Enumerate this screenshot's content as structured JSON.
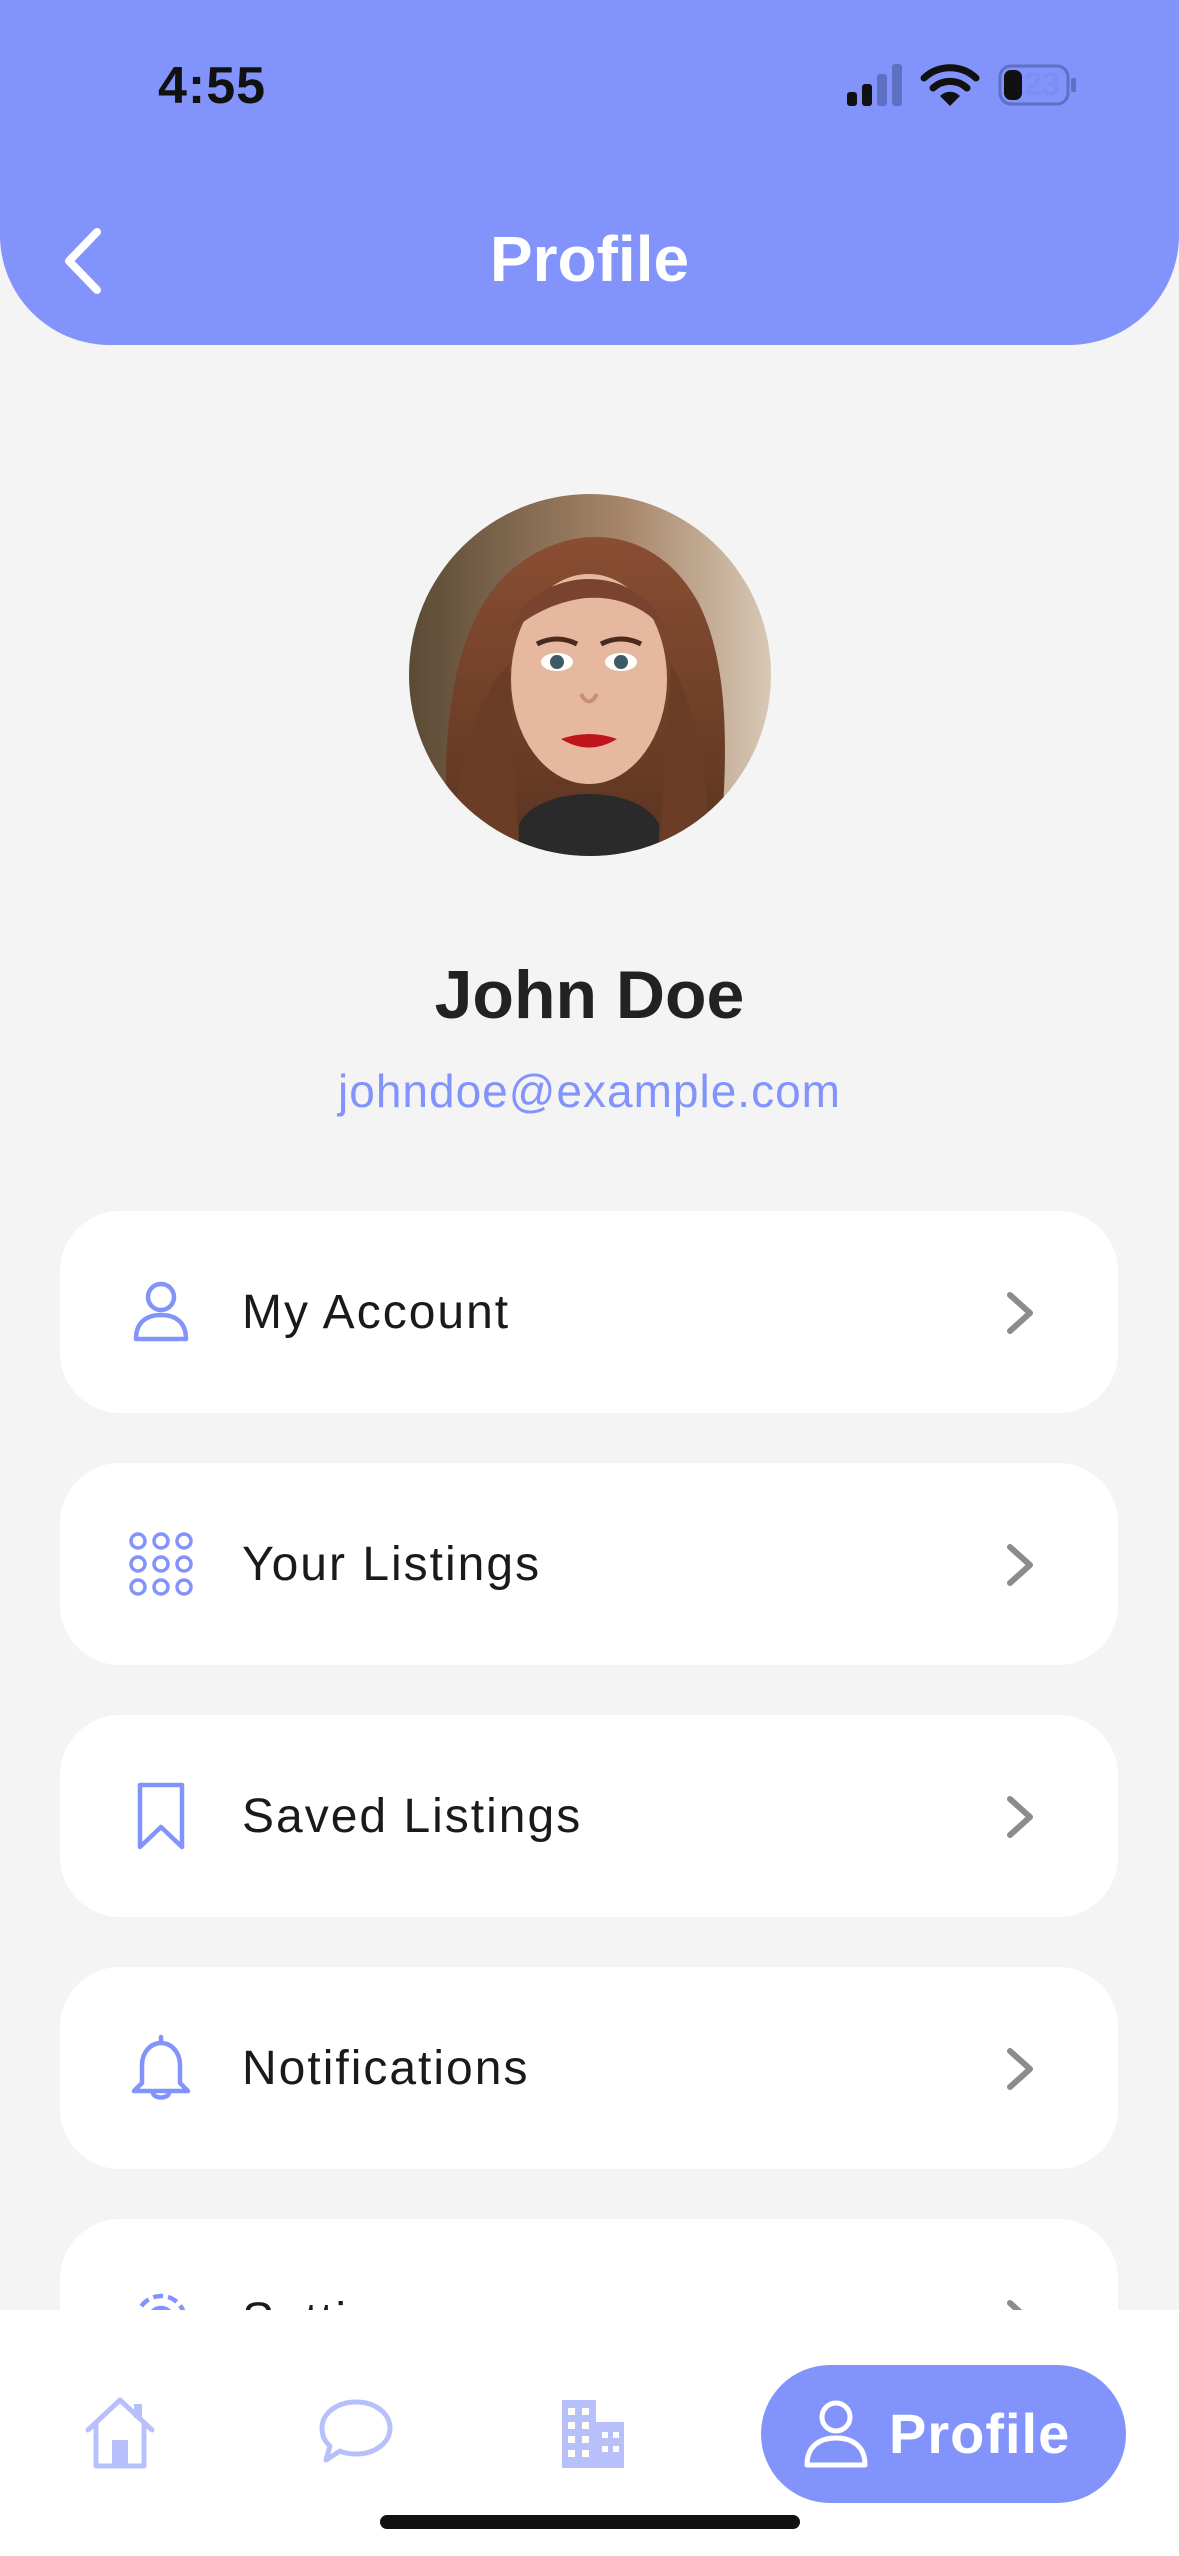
{
  "status_bar": {
    "time": "4:55",
    "battery": "23"
  },
  "header": {
    "title": "Profile"
  },
  "profile": {
    "name": "John Doe",
    "email": "johndoe@example.com"
  },
  "menu": {
    "items": [
      {
        "label": "My Account",
        "icon": "user-icon"
      },
      {
        "label": "Your Listings",
        "icon": "grid-dots-icon"
      },
      {
        "label": "Saved Listings",
        "icon": "bookmark-icon"
      },
      {
        "label": "Notifications",
        "icon": "bell-icon"
      },
      {
        "label": "Setti",
        "icon": "gear-icon"
      }
    ]
  },
  "bottom_nav": {
    "items": [
      {
        "icon": "home-icon"
      },
      {
        "icon": "chat-bubble-icon"
      },
      {
        "icon": "buildings-icon"
      }
    ],
    "active_label": "Profile"
  },
  "colors": {
    "accent": "#8294fb",
    "background": "#f4f4f4",
    "card": "#ffffff",
    "text": "#1a1a1a"
  }
}
